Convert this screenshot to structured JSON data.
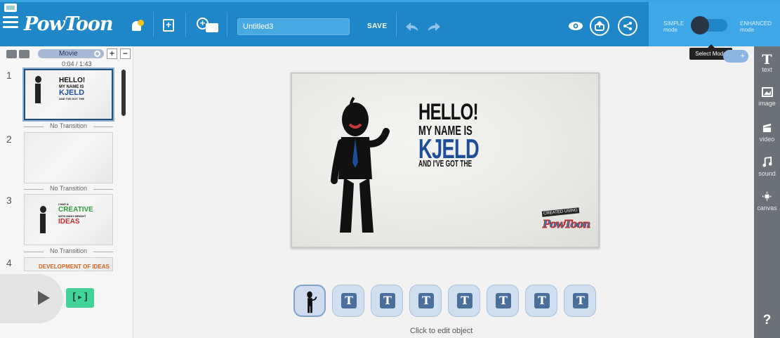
{
  "app": {
    "logo_text": "PowToon"
  },
  "toolbar": {
    "title_value": "Untitled3",
    "save_label": "SAVE",
    "mode_left_1": "SIMPLE",
    "mode_left_2": "mode",
    "mode_right_1": "ENHANCED",
    "mode_right_2": "mode",
    "mode_tooltip": "Select Mode"
  },
  "slides_panel": {
    "mode_label": "Movie",
    "timecode": "0:04 / 1:43",
    "slides": [
      {
        "number": "1",
        "lines": [
          "HELLO!",
          "MY NAME IS",
          "KJELD",
          "AND I'VE GOT THE"
        ]
      },
      {
        "number": "2",
        "lines": []
      },
      {
        "number": "3",
        "lines": [
          "I HAD A",
          "CREATIVE",
          "WITH MANY BRIGHT",
          "IDEAS"
        ]
      },
      {
        "number": "4",
        "lines": [
          "DEVELOPMENT OF IDEAS"
        ]
      }
    ],
    "transition_label": "No Transition"
  },
  "canvas": {
    "line1": "HELLO!",
    "line2": "MY NAME IS",
    "line3": "KJELD",
    "line4": "AND I'VE GOT THE",
    "credit_small": "CREATED USING",
    "credit_logo": "PowToon"
  },
  "object_bar": {
    "items": [
      "T",
      "T",
      "T",
      "T",
      "T",
      "T",
      "T"
    ],
    "hint": "Click to edit object"
  },
  "right_toolbar": {
    "items": [
      {
        "icon": "T",
        "label": "text"
      },
      {
        "icon": "image-icon",
        "label": "image"
      },
      {
        "icon": "video-icon",
        "label": "video"
      },
      {
        "icon": "sound-icon",
        "label": "sound"
      },
      {
        "icon": "canvas-icon",
        "label": "canvas"
      }
    ],
    "help": "?"
  },
  "colors": {
    "topbar": "#1f86c8",
    "mode_panel": "#3da7e8",
    "right_toolbar": "#6c7077",
    "name_blue": "#1d4e9a",
    "preview_green": "#44d49b"
  }
}
